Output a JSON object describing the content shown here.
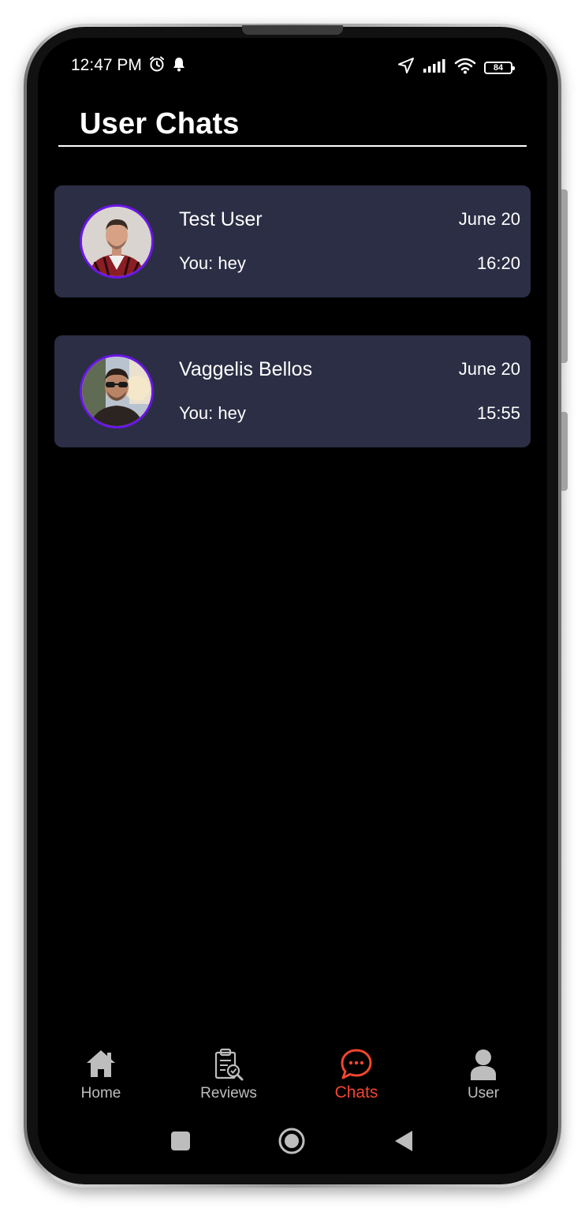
{
  "status_bar": {
    "time": "12:47 PM",
    "battery_level": "84",
    "left_icons": [
      "alarm-icon",
      "notification-bell-icon"
    ],
    "right_icons": [
      "location-arrow-icon",
      "signal-bars-icon",
      "wifi-icon",
      "battery-icon"
    ]
  },
  "header": {
    "title": "User Chats"
  },
  "chats": [
    {
      "name": "Test User",
      "date": "June 20",
      "preview": "You: hey",
      "time": "16:20",
      "avatar": "profile-photo"
    },
    {
      "name": "Vaggelis Bellos",
      "date": "June 20",
      "preview": "You: hey",
      "time": "15:55",
      "avatar": "profile-photo"
    }
  ],
  "bottom_nav": {
    "active": "Chats",
    "items": [
      {
        "label": "Home",
        "icon": "home-icon"
      },
      {
        "label": "Reviews",
        "icon": "clipboard-check-icon"
      },
      {
        "label": "Chats",
        "icon": "chat-bubble-icon"
      },
      {
        "label": "User",
        "icon": "user-icon"
      }
    ]
  },
  "system_nav": {
    "buttons": [
      "recents-square-icon",
      "home-circle-icon",
      "back-triangle-icon"
    ]
  },
  "colors": {
    "background": "#000000",
    "card": "#2b2e44",
    "avatar_ring": "#6a16e8",
    "accent": "#f2462e",
    "inactive_nav": "#bdbdbd"
  }
}
